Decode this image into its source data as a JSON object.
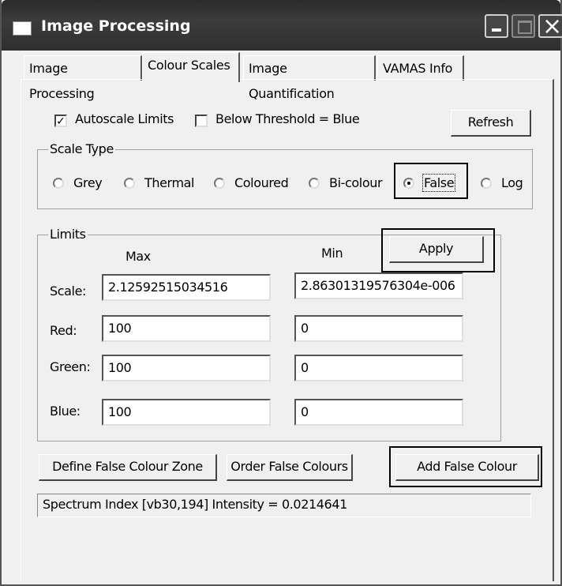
{
  "window": {
    "title": "Image Processing"
  },
  "tabs": [
    {
      "label": "Image Processing"
    },
    {
      "label": "Colour Scales"
    },
    {
      "label": "Image Quantification"
    },
    {
      "label": "VAMAS Info"
    }
  ],
  "active_tab": "Colour Scales",
  "options": {
    "autoscale_label": "Autoscale Limits",
    "autoscale_checked": true,
    "below_threshold_label": "Below Threshold = Blue",
    "below_threshold_checked": false,
    "refresh_label": "Refresh"
  },
  "scale_type": {
    "title": "Scale Type",
    "options": [
      "Grey",
      "Thermal",
      "Coloured",
      "Bi-colour",
      "False",
      "Log"
    ],
    "selected": "False"
  },
  "limits": {
    "title": "Limits",
    "max_header": "Max",
    "min_header": "Min",
    "apply_label": "Apply",
    "rows": [
      {
        "label": "Scale:",
        "max": "2.12592515034516",
        "min": "2.86301319576304e-006"
      },
      {
        "label": "Red:",
        "max": "100",
        "min": "0"
      },
      {
        "label": "Green:",
        "max": "100",
        "min": "0"
      },
      {
        "label": "Blue:",
        "max": "100",
        "min": "0"
      }
    ]
  },
  "actions": {
    "define_zone": "Define False Colour Zone",
    "order_colours": "Order False Colours",
    "add_colour": "Add False Colour"
  },
  "status": {
    "text": "Spectrum Index [vb30,194] Intensity = 0.0214641"
  }
}
